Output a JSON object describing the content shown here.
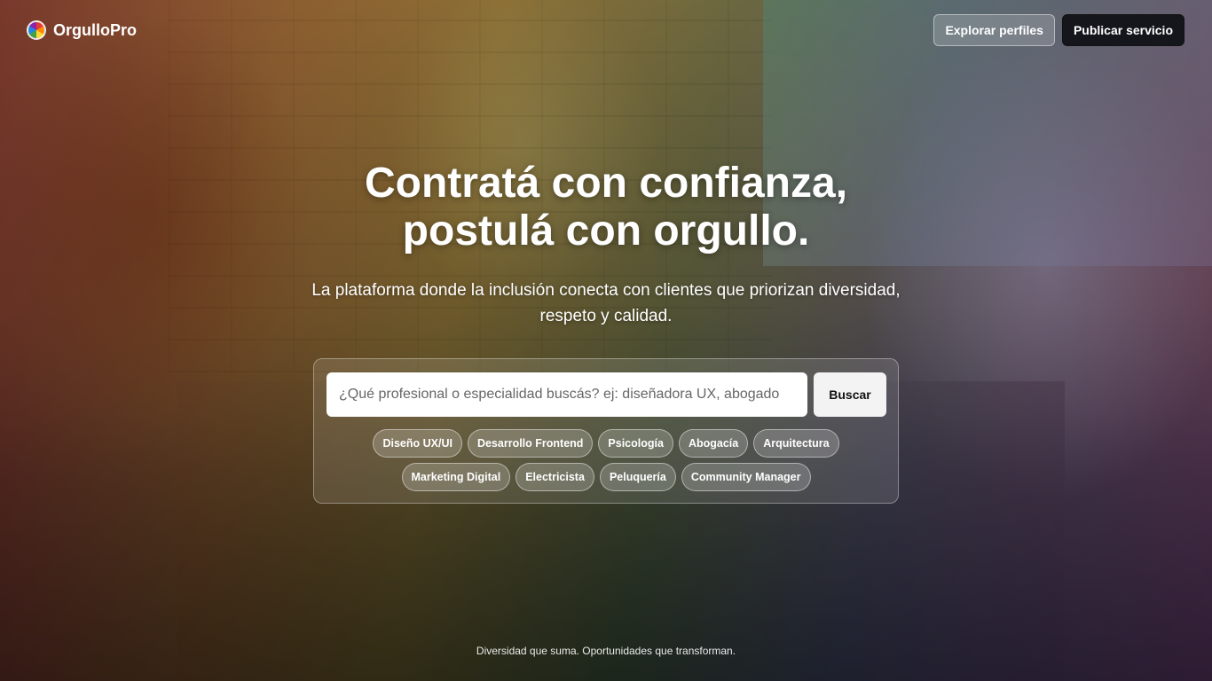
{
  "brand": {
    "name": "OrgulloPro",
    "logo_icon": "pride-circle-icon"
  },
  "nav": {
    "explore_label": "Explorar perfiles",
    "publish_label": "Publicar servicio"
  },
  "hero": {
    "title_line1": "Contratá con confianza,",
    "title_line2": "postulá con orgullo.",
    "subtitle": "La plataforma donde la inclusión conecta con clientes que priorizan diversidad, respeto y calidad."
  },
  "search": {
    "placeholder": "¿Qué profesional o especialidad buscás? ej: diseñadora UX, abogado",
    "value": "",
    "button_label": "Buscar"
  },
  "chips": [
    "Diseño UX/UI",
    "Desarrollo Frontend",
    "Psicología",
    "Abogacía",
    "Arquitectura",
    "Marketing Digital",
    "Electricista",
    "Peluquería",
    "Community Manager"
  ],
  "footer": {
    "tagline": "Diversidad que suma. Oportunidades que transforman."
  },
  "colors": {
    "primary_dark": "#15151c",
    "text": "#ffffff"
  }
}
